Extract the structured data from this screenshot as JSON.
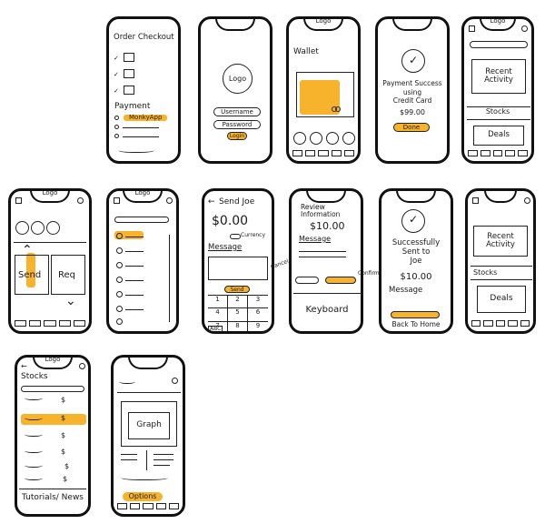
{
  "checkout": {
    "title": "Order Checkout",
    "payment_label": "Payment",
    "selected_method": "MonkyApp"
  },
  "login": {
    "logo": "Logo",
    "username": "Username",
    "password": "Password",
    "login_btn": "Login"
  },
  "wallet": {
    "logo": "Logo",
    "title": "Wallet"
  },
  "payment_success": {
    "line1": "Payment Success",
    "line2": "using",
    "line3": "Credit Card",
    "amount": "$99.00",
    "done_btn": "Done"
  },
  "home1": {
    "logo": "Logo",
    "recent_activity": "Recent Activity",
    "stocks": "Stocks",
    "deals": "Deals"
  },
  "send_request": {
    "logo": "Logo",
    "send": "Send",
    "request": "Req"
  },
  "contacts": {
    "logo": "Logo"
  },
  "send_joe": {
    "title": "Send Joe",
    "back_arrow": "←",
    "amount": "$0.00",
    "currency": "Currency",
    "message_label": "Message",
    "send_btn": "Send",
    "keypad": [
      "1",
      "2",
      "3",
      "4",
      "5",
      "6",
      "7",
      "8",
      "9"
    ],
    "abc": "ABC"
  },
  "review": {
    "title_line1": "Review",
    "title_line2": "Information",
    "amount": "$10.00",
    "message_label": "Message",
    "cancel": "Cancel",
    "confirm": "Confirm",
    "keyboard": "Keyboard"
  },
  "sent": {
    "line1": "Successfully",
    "line2": "Sent to",
    "line3": "Joe",
    "amount": "$10.00",
    "message_label": "Message",
    "back_home": "Back To Home"
  },
  "home2": {
    "recent_activity": "Recent Activity",
    "stocks": "Stocks",
    "deals": "Deals"
  },
  "stocks_list": {
    "logo": "Logo",
    "title": "Stocks",
    "dollar": "$",
    "footer": "Tutorials/ News"
  },
  "graph_screen": {
    "graph": "Graph",
    "options": "Options"
  },
  "colors": {
    "accent": "#f7b32b",
    "ink": "#111111"
  },
  "icons": [
    "check-icon",
    "circle-icon",
    "back-arrow-icon",
    "checkmark-circle-icon",
    "chevron-up-icon",
    "chevron-down-icon"
  ]
}
